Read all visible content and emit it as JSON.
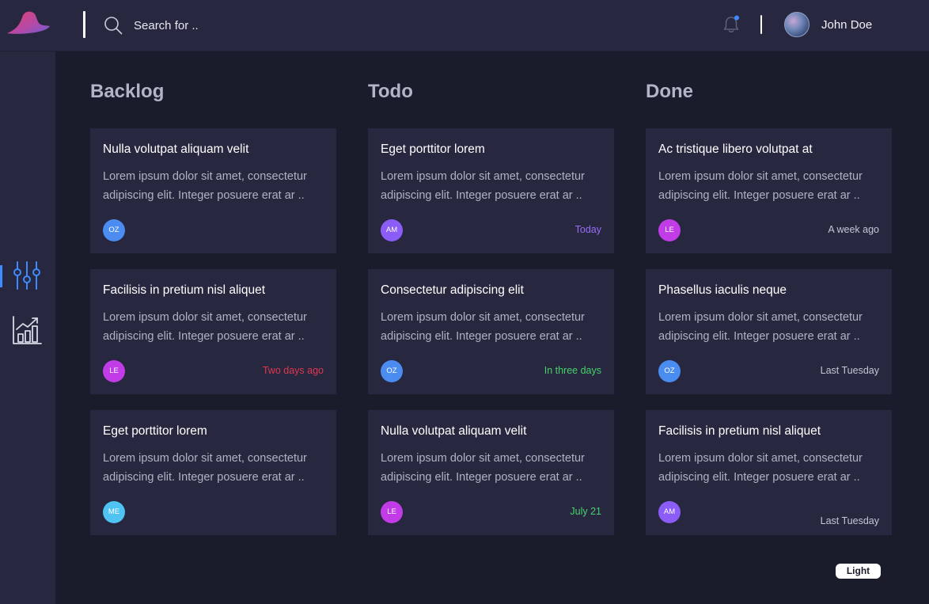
{
  "header": {
    "search": {
      "placeholder": "Search for .."
    },
    "user": {
      "name": "John Doe"
    },
    "notification_dot_color": "#3d8bff"
  },
  "sidebar": {
    "items": [
      {
        "icon": "sliders-icon",
        "active": true
      },
      {
        "icon": "bar-chart-growth-icon",
        "active": false
      }
    ]
  },
  "board": {
    "columns": [
      {
        "title": "Backlog",
        "cards": [
          {
            "title": "Nulla volutpat aliquam velit",
            "description": "Lorem ipsum dolor sit amet, consectetur adipiscing elit. Integer posuere erat ar ..",
            "initials": "OZ",
            "avatar_color": "#4a8cf0",
            "date": "",
            "date_color": ""
          },
          {
            "title": "Facilisis in pretium nisl aliquet",
            "description": "Lorem ipsum dolor sit amet, consectetur adipiscing elit. Integer posuere erat ar ..",
            "initials": "LE",
            "avatar_color": "#c13ce6",
            "date": "Two days ago",
            "date_color": "#e0364f"
          },
          {
            "title": "Eget porttitor lorem",
            "description": "Lorem ipsum dolor sit amet, consectetur adipiscing elit. Integer posuere erat ar ..",
            "initials": "ME",
            "avatar_color": "#4fc3f2",
            "date": "",
            "date_color": ""
          }
        ]
      },
      {
        "title": "Todo",
        "cards": [
          {
            "title": "Eget porttitor lorem",
            "description": "Lorem ipsum dolor sit amet, consectetur adipiscing elit. Integer posuere erat ar ..",
            "initials": "AM",
            "avatar_color": "#8b5cf6",
            "date": "Today",
            "date_color": "#9a6cf7"
          },
          {
            "title": "Consectetur adipiscing elit",
            "description": "Lorem ipsum dolor sit amet, consectetur adipiscing elit. Integer posuere erat ar ..",
            "initials": "OZ",
            "avatar_color": "#4a8cf0",
            "date": "In three days",
            "date_color": "#47d16a"
          },
          {
            "title": "Nulla volutpat aliquam velit",
            "description": "Lorem ipsum dolor sit amet, consectetur adipiscing elit. Integer posuere erat ar ..",
            "initials": "LE",
            "avatar_color": "#c13ce6",
            "date": "July 21",
            "date_color": "#47d16a"
          }
        ]
      },
      {
        "title": "Done",
        "cards": [
          {
            "title": "Ac tristique libero volutpat at",
            "description": "Lorem ipsum dolor sit amet, consectetur adipiscing elit. Integer posuere erat ar ..",
            "initials": "LE",
            "avatar_color": "#c13ce6",
            "date": "A week ago",
            "date_color": "#c4c6d4"
          },
          {
            "title": "Phasellus iaculis neque",
            "description": "Lorem ipsum dolor sit amet, consectetur adipiscing elit. Integer posuere erat ar ..",
            "initials": "OZ",
            "avatar_color": "#4a8cf0",
            "date": "Last Tuesday",
            "date_color": "#c4c6d4"
          },
          {
            "title": "Facilisis in pretium nisl aliquet",
            "description": "Lorem ipsum dolor sit amet, consectetur adipiscing elit. Integer posuere erat ar ..",
            "initials": "AM",
            "avatar_color": "#8b5cf6",
            "date": "Last Tuesday",
            "date_color": "#c4c6d4"
          }
        ]
      }
    ]
  },
  "theme_toggle": {
    "label": "Light"
  }
}
